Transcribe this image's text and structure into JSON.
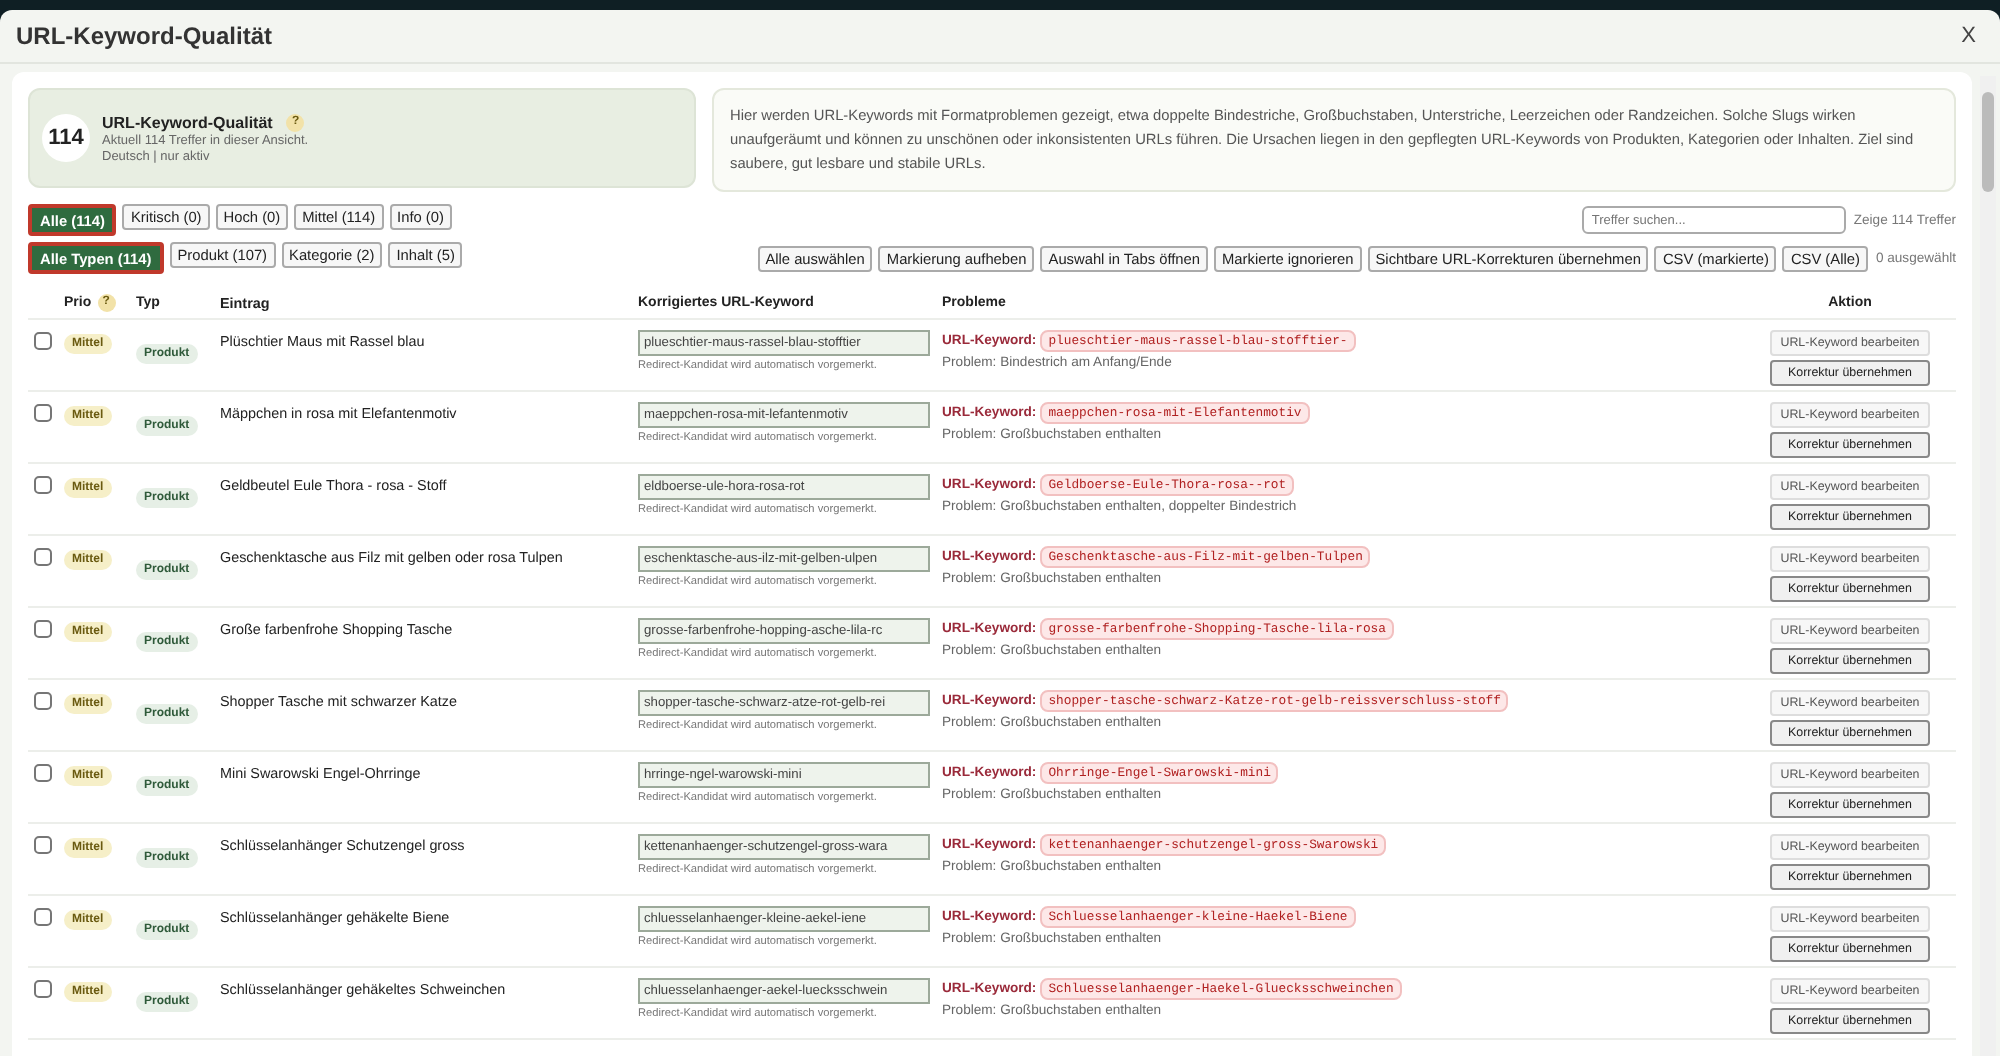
{
  "window": {
    "title": "URL-Keyword-Qualität",
    "close": "X"
  },
  "summary": {
    "count": "114",
    "title": "URL-Keyword-Qualität",
    "help": "?",
    "subtitle": "Aktuell 114 Treffer in dieser Ansicht.",
    "meta": "Deutsch | nur aktiv"
  },
  "description": "Hier werden URL-Keywords mit Formatproblemen gezeigt, etwa doppelte Bindestriche, Großbuchstaben, Unterstriche, Leerzeichen oder Randzeichen. Solche Slugs wirken unaufgeräumt und können zu unschönen oder inkonsistenten URLs führen. Die Ursachen liegen in den gepflegten URL-Keywords von Produkten, Kategorien oder Inhalten. Ziel sind saubere, gut lesbare und stabile URLs.",
  "priority_filters": [
    {
      "label": "Alle (114)",
      "selected": true
    },
    {
      "label": "Kritisch (0)",
      "selected": false
    },
    {
      "label": "Hoch (0)",
      "selected": false
    },
    {
      "label": "Mittel (114)",
      "selected": false
    },
    {
      "label": "Info (0)",
      "selected": false
    }
  ],
  "search": {
    "placeholder": "Treffer suchen..."
  },
  "result_count": "Zeige 114 Treffer",
  "type_filters": [
    {
      "label": "Alle Typen (114)",
      "selected": true
    },
    {
      "label": "Produkt (107)",
      "selected": false
    },
    {
      "label": "Kategorie (2)",
      "selected": false
    },
    {
      "label": "Inhalt (5)",
      "selected": false
    }
  ],
  "bulk_actions": [
    "Alle auswählen",
    "Markierung aufheben",
    "Auswahl in Tabs öffnen",
    "Markierte ignorieren",
    "Sichtbare URL-Korrekturen übernehmen",
    "CSV (markierte)",
    "CSV (Alle)"
  ],
  "selected_count": "0 ausgewählt",
  "table": {
    "columns": [
      {
        "label": "Prio",
        "help": "?"
      },
      {
        "label": "Typ"
      },
      {
        "label": "Eintrag"
      },
      {
        "label": "Korrigiertes URL-Keyword"
      },
      {
        "label": "Probleme"
      },
      {
        "label": "Aktion"
      }
    ],
    "rows": [
      {
        "checked": false,
        "priority": "Mittel",
        "type": "Produkt",
        "entry": "Plüschtier Maus mit Rassel blau",
        "slug": "plueschtier-maus-rassel-blau-stofftier",
        "slug_note": "Redirect-Kandidat wird automatisch vorgemerkt.",
        "keyword_label": "URL-Keyword:",
        "keyword": "plueschtier-maus-rassel-blau-stofftier-",
        "problem": "Problem: Bindestrich am Anfang/Ende",
        "actions": [
          "URL-Keyword bearbeiten",
          "Korrektur übernehmen"
        ]
      },
      {
        "checked": false,
        "priority": "Mittel",
        "type": "Produkt",
        "entry": "Mäppchen in rosa mit Elefantenmotiv",
        "slug": "maeppchen-rosa-mit-lefantenmotiv",
        "slug_note": "Redirect-Kandidat wird automatisch vorgemerkt.",
        "keyword_label": "URL-Keyword:",
        "keyword": "maeppchen-rosa-mit-Elefantenmotiv",
        "problem": "Problem: Großbuchstaben enthalten",
        "actions": [
          "URL-Keyword bearbeiten",
          "Korrektur übernehmen"
        ]
      },
      {
        "checked": false,
        "priority": "Mittel",
        "type": "Produkt",
        "entry": "Geldbeutel Eule Thora - rosa - Stoff",
        "slug": "eldboerse-ule-hora-rosa-rot",
        "slug_note": "Redirect-Kandidat wird automatisch vorgemerkt.",
        "keyword_label": "URL-Keyword:",
        "keyword": "Geldboerse-Eule-Thora-rosa--rot",
        "problem": "Problem: Großbuchstaben enthalten, doppelter Bindestrich",
        "actions": [
          "URL-Keyword bearbeiten",
          "Korrektur übernehmen"
        ]
      },
      {
        "checked": false,
        "priority": "Mittel",
        "type": "Produkt",
        "entry": "Geschenktasche aus Filz mit gelben oder rosa Tulpen",
        "slug": "eschenktasche-aus-ilz-mit-gelben-ulpen",
        "slug_note": "Redirect-Kandidat wird automatisch vorgemerkt.",
        "keyword_label": "URL-Keyword:",
        "keyword": "Geschenktasche-aus-Filz-mit-gelben-Tulpen",
        "problem": "Problem: Großbuchstaben enthalten",
        "actions": [
          "URL-Keyword bearbeiten",
          "Korrektur übernehmen"
        ]
      },
      {
        "checked": false,
        "priority": "Mittel",
        "type": "Produkt",
        "entry": "Große farbenfrohe Shopping Tasche",
        "slug": "grosse-farbenfrohe-hopping-asche-lila-rc",
        "slug_note": "Redirect-Kandidat wird automatisch vorgemerkt.",
        "keyword_label": "URL-Keyword:",
        "keyword": "grosse-farbenfrohe-Shopping-Tasche-lila-rosa",
        "problem": "Problem: Großbuchstaben enthalten",
        "actions": [
          "URL-Keyword bearbeiten",
          "Korrektur übernehmen"
        ]
      },
      {
        "checked": false,
        "priority": "Mittel",
        "type": "Produkt",
        "entry": "Shopper Tasche mit schwarzer Katze",
        "slug": "shopper-tasche-schwarz-atze-rot-gelb-rei",
        "slug_note": "Redirect-Kandidat wird automatisch vorgemerkt.",
        "keyword_label": "URL-Keyword:",
        "keyword": "shopper-tasche-schwarz-Katze-rot-gelb-reissverschluss-stoff",
        "problem": "Problem: Großbuchstaben enthalten",
        "actions": [
          "URL-Keyword bearbeiten",
          "Korrektur übernehmen"
        ]
      },
      {
        "checked": false,
        "priority": "Mittel",
        "type": "Produkt",
        "entry": "Mini Swarowski Engel-Ohrringe",
        "slug": "hrringe-ngel-warowski-mini",
        "slug_note": "Redirect-Kandidat wird automatisch vorgemerkt.",
        "keyword_label": "URL-Keyword:",
        "keyword": "Ohrringe-Engel-Swarowski-mini",
        "problem": "Problem: Großbuchstaben enthalten",
        "actions": [
          "URL-Keyword bearbeiten",
          "Korrektur übernehmen"
        ]
      },
      {
        "checked": false,
        "priority": "Mittel",
        "type": "Produkt",
        "entry": "Schlüsselanhänger Schutzengel gross",
        "slug": "kettenanhaenger-schutzengel-gross-wara",
        "slug_note": "Redirect-Kandidat wird automatisch vorgemerkt.",
        "keyword_label": "URL-Keyword:",
        "keyword": "kettenanhaenger-schutzengel-gross-Swarowski",
        "problem": "Problem: Großbuchstaben enthalten",
        "actions": [
          "URL-Keyword bearbeiten",
          "Korrektur übernehmen"
        ]
      },
      {
        "checked": false,
        "priority": "Mittel",
        "type": "Produkt",
        "entry": "Schlüsselanhänger gehäkelte Biene",
        "slug": "chluesselanhaenger-kleine-aekel-iene",
        "slug_note": "Redirect-Kandidat wird automatisch vorgemerkt.",
        "keyword_label": "URL-Keyword:",
        "keyword": "Schluesselanhaenger-kleine-Haekel-Biene",
        "problem": "Problem: Großbuchstaben enthalten",
        "actions": [
          "URL-Keyword bearbeiten",
          "Korrektur übernehmen"
        ]
      },
      {
        "checked": false,
        "priority": "Mittel",
        "type": "Produkt",
        "entry": "Schlüsselanhänger gehäkeltes Schweinchen",
        "slug": "chluesselanhaenger-aekel-luecksschwein",
        "slug_note": "Redirect-Kandidat wird automatisch vorgemerkt.",
        "keyword_label": "URL-Keyword:",
        "keyword": "Schluesselanhaenger-Haekel-Gluecksschweinchen",
        "problem": "Problem: Großbuchstaben enthalten",
        "actions": [
          "URL-Keyword bearbeiten",
          "Korrektur übernehmen"
        ]
      }
    ]
  }
}
